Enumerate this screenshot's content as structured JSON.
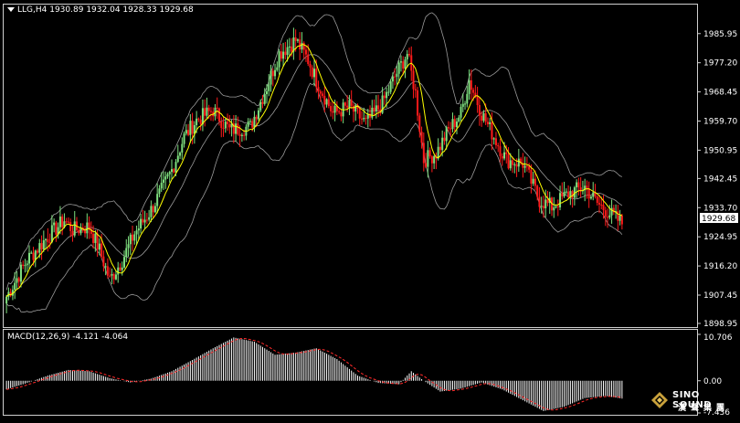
{
  "header": {
    "symbol_timeframe": "LLG,H4",
    "open": "1930.89",
    "high": "1932.04",
    "low": "1928.33",
    "close": "1929.68"
  },
  "price_axis": {
    "ticks": [
      "1985.95",
      "1977.20",
      "1968.45",
      "1959.70",
      "1950.95",
      "1942.45",
      "1933.70",
      "1924.95",
      "1916.20",
      "1907.45",
      "1898.95"
    ],
    "current_price": "1929.68"
  },
  "macd": {
    "label": "MACD(12,26,9)",
    "main_value": "-4.121",
    "signal_value": "-4.064",
    "axis_ticks": [
      "10.706",
      "0.00",
      "-7.436"
    ]
  },
  "logo": {
    "line1": "SINO SOUND",
    "line2": "漢聲集團"
  },
  "colors": {
    "background": "#000000",
    "bull_candle": "#7fe07f",
    "bear_candle": "#ff1a1a",
    "moving_average": "#ffff00",
    "bollinger": "#9a9a9a",
    "macd_histogram": "#ffffff",
    "macd_signal": "#ff2a2a"
  },
  "chart_data": {
    "type": "candlestick",
    "ylim": [
      1898.95,
      1990.0
    ],
    "yticks": [
      1985.95,
      1977.2,
      1968.45,
      1959.7,
      1950.95,
      1942.45,
      1933.7,
      1924.95,
      1916.2,
      1907.45,
      1898.95
    ],
    "current_price": 1929.68,
    "anchors_close": [
      [
        0,
        1907
      ],
      [
        10,
        1918
      ],
      [
        20,
        1925
      ],
      [
        28,
        1930
      ],
      [
        32,
        1927
      ],
      [
        40,
        1928
      ],
      [
        45,
        1921
      ],
      [
        50,
        1912
      ],
      [
        56,
        1918
      ],
      [
        62,
        1926
      ],
      [
        70,
        1933
      ],
      [
        76,
        1940
      ],
      [
        80,
        1945
      ],
      [
        86,
        1955
      ],
      [
        92,
        1960
      ],
      [
        100,
        1963
      ],
      [
        108,
        1957
      ],
      [
        118,
        1958
      ],
      [
        126,
        1970
      ],
      [
        132,
        1980
      ],
      [
        140,
        1984
      ],
      [
        146,
        1978
      ],
      [
        150,
        1972
      ],
      [
        158,
        1962
      ],
      [
        166,
        1964
      ],
      [
        174,
        1959
      ],
      [
        182,
        1965
      ],
      [
        188,
        1973
      ],
      [
        194,
        1980
      ],
      [
        198,
        1968
      ],
      [
        202,
        1948
      ],
      [
        208,
        1950
      ],
      [
        214,
        1957
      ],
      [
        220,
        1962
      ],
      [
        224,
        1972
      ],
      [
        230,
        1962
      ],
      [
        236,
        1955
      ],
      [
        242,
        1948
      ],
      [
        250,
        1947
      ],
      [
        258,
        1936
      ],
      [
        264,
        1934
      ],
      [
        272,
        1938
      ],
      [
        280,
        1940
      ],
      [
        286,
        1935
      ],
      [
        292,
        1932
      ],
      [
        298,
        1929
      ]
    ],
    "macd": {
      "ylim": [
        -7.436,
        10.706
      ],
      "anchors": [
        [
          0,
          -2
        ],
        [
          10,
          -0.5
        ],
        [
          20,
          1.2
        ],
        [
          30,
          2.5
        ],
        [
          40,
          2.2
        ],
        [
          50,
          0.6
        ],
        [
          60,
          -0.4
        ],
        [
          70,
          0.5
        ],
        [
          80,
          2.2
        ],
        [
          90,
          4.8
        ],
        [
          100,
          7.5
        ],
        [
          110,
          10
        ],
        [
          120,
          9
        ],
        [
          130,
          6
        ],
        [
          140,
          6.5
        ],
        [
          150,
          7.5
        ],
        [
          160,
          5
        ],
        [
          170,
          1.2
        ],
        [
          180,
          -0.5
        ],
        [
          190,
          -0.8
        ],
        [
          196,
          2.2
        ],
        [
          202,
          0
        ],
        [
          210,
          -2.5
        ],
        [
          220,
          -1.8
        ],
        [
          230,
          -0.4
        ],
        [
          240,
          -2
        ],
        [
          250,
          -4.5
        ],
        [
          260,
          -7
        ],
        [
          270,
          -6
        ],
        [
          280,
          -4
        ],
        [
          290,
          -3.5
        ],
        [
          298,
          -4.121
        ]
      ],
      "signal_lag": 6
    }
  }
}
